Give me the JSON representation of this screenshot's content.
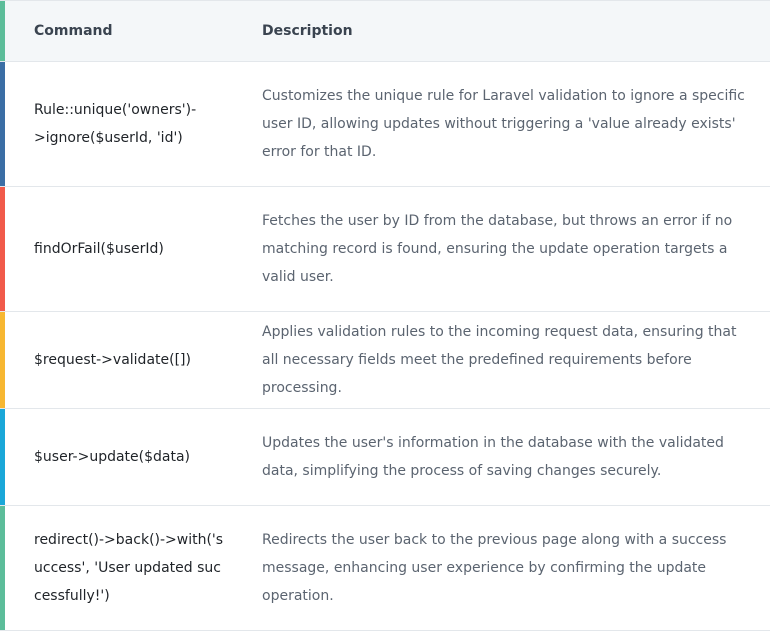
{
  "header": {
    "command_label": "Command",
    "description_label": "Description",
    "accent": "#5cbd9a"
  },
  "rows": [
    {
      "command": "Rule::unique('owners')->ignore($userId, 'id')",
      "description": "Customizes the unique rule for Laravel validation to ignore a specific user ID, allowing updates without triggering a 'value already exists' error for that ID.",
      "accent": "#3b6ea5"
    },
    {
      "command": "findOrFail($userId)",
      "description": "Fetches the user by ID from the database, but throws an error if no matching record is found, ensuring the update operation targets a valid user.",
      "accent": "#f15a4a"
    },
    {
      "command": "$request->validate([])",
      "description": "Applies validation rules to the incoming request data, ensuring that all necessary fields meet the predefined requirements before processing.",
      "accent": "#f7b731"
    },
    {
      "command": "$user->update($data)",
      "description": "Updates the user's information in the database with the validated data, simplifying the process of saving changes securely.",
      "accent": "#1aa7d8"
    },
    {
      "command": "redirect()->back()->with('success', 'User updated successfully!')",
      "description": "Redirects the user back to the previous page along with a success message, enhancing user experience by confirming the update operation.",
      "accent": "#5cbd9a"
    }
  ]
}
